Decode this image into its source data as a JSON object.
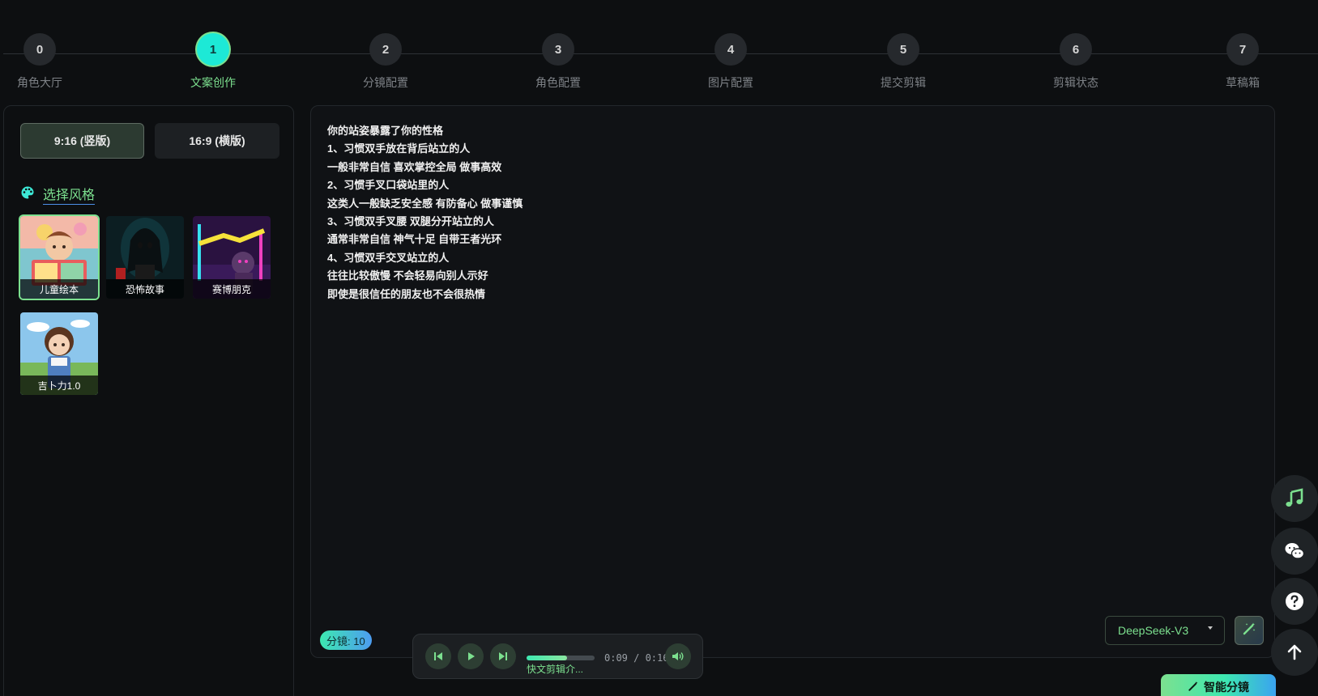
{
  "steps": [
    {
      "number": "0",
      "label": "角色大厅"
    },
    {
      "number": "1",
      "label": "文案创作"
    },
    {
      "number": "2",
      "label": "分镜配置"
    },
    {
      "number": "3",
      "label": "角色配置"
    },
    {
      "number": "4",
      "label": "图片配置"
    },
    {
      "number": "5",
      "label": "提交剪辑"
    },
    {
      "number": "6",
      "label": "剪辑状态"
    },
    {
      "number": "7",
      "label": "草稿箱"
    }
  ],
  "active_step": 1,
  "aspect_ratio": {
    "options": [
      "9:16 (竖版)",
      "16:9 (横版)"
    ],
    "selected": "9:16 (竖版)"
  },
  "style_section": {
    "title": "选择风格",
    "styles": [
      {
        "label": "儿童绘本",
        "selected": true
      },
      {
        "label": "恐怖故事",
        "selected": false
      },
      {
        "label": "赛博朋克",
        "selected": false
      },
      {
        "label": "吉卜力1.0",
        "selected": false
      }
    ]
  },
  "editor": {
    "lines": [
      "你的站姿暴露了你的性格",
      "1、习惯双手放在背后站立的人",
      "一般非常自信 喜欢掌控全局 做事高效",
      "2、习惯手叉口袋站里的人",
      "这类人一般缺乏安全感 有防备心 做事谨慎",
      "3、习惯双手叉腰 双腿分开站立的人",
      "通常非常自信 神气十足 自带王者光环",
      "4、习惯双手交叉站立的人",
      "往往比较傲慢 不会轻易向别人示好",
      "即使是很信任的朋友也不会很热情"
    ],
    "shot_count_label": "分镜: 10",
    "model": "DeepSeek-V3"
  },
  "player": {
    "title": "快文剪辑介...",
    "time": "0:09 / 0:16",
    "progress": 0.6
  },
  "smart_button_label": "智能分镜",
  "colors": {
    "accent": "#7ce08f",
    "active_step": "#1de9d6",
    "background": "#0d0f11"
  },
  "icons": [
    "palette-icon",
    "previous-icon",
    "play-icon",
    "next-icon",
    "volume-icon",
    "magic-wand-icon",
    "music-icon",
    "wechat-icon",
    "help-icon",
    "arrow-up-icon"
  ]
}
